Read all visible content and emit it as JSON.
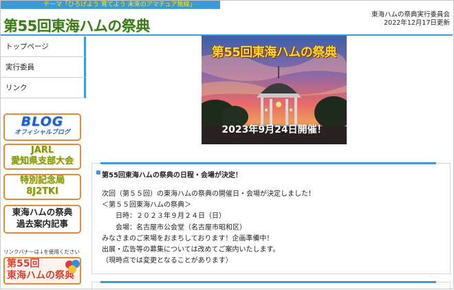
{
  "header": {
    "theme": "テーマ「ひろげよう 育てよう 未来のアマチュア無線」",
    "site_title": "第55回東海ハムの祭典",
    "organizer": "東海ハムの祭典実行委員会",
    "updated": "2022年12月17日更新"
  },
  "nav": {
    "items": [
      {
        "label": "トップページ"
      },
      {
        "label": "実行委員"
      },
      {
        "label": "リンク"
      }
    ]
  },
  "banners": {
    "blog_big": "BLOG",
    "blog_small": "オフィシャルブログ",
    "jarl_line1": "JARL",
    "jarl_line2": "愛知県支部大会",
    "special_line1": "特別記念局",
    "special_line2": "8J2TKI",
    "past_line1": "東海ハムの祭典",
    "past_line2": "過去案内記事",
    "link_note": "リンクバナーは↓を使用ください",
    "fest_line1": "第55回",
    "fest_line2": "東海ハムの祭典"
  },
  "hero": {
    "title": "第55回東海ハムの祭典",
    "date": "2023年9月24日開催！"
  },
  "article": {
    "title": "第55回東海ハムの祭典の日程・会場が決定！",
    "body": "次回（第５５回）の東海ハムの祭典の開催日・会場が決定しました！\n＜第５５回東海ハムの祭典＞\n　　日時：２０２３年９月２４日（日）\n　　会場：名古屋市公会堂（名古屋市昭和区）\nみなさまのご来場をおまちしております！企画準備中！\n出展・広告等の募集については改めてご案内いたします。\n（現時点では変更となることがあります）"
  },
  "colors": {
    "accent": "#3d9ad6",
    "title_green": "#3b7a1c",
    "banner_border": "#e08a3a"
  }
}
